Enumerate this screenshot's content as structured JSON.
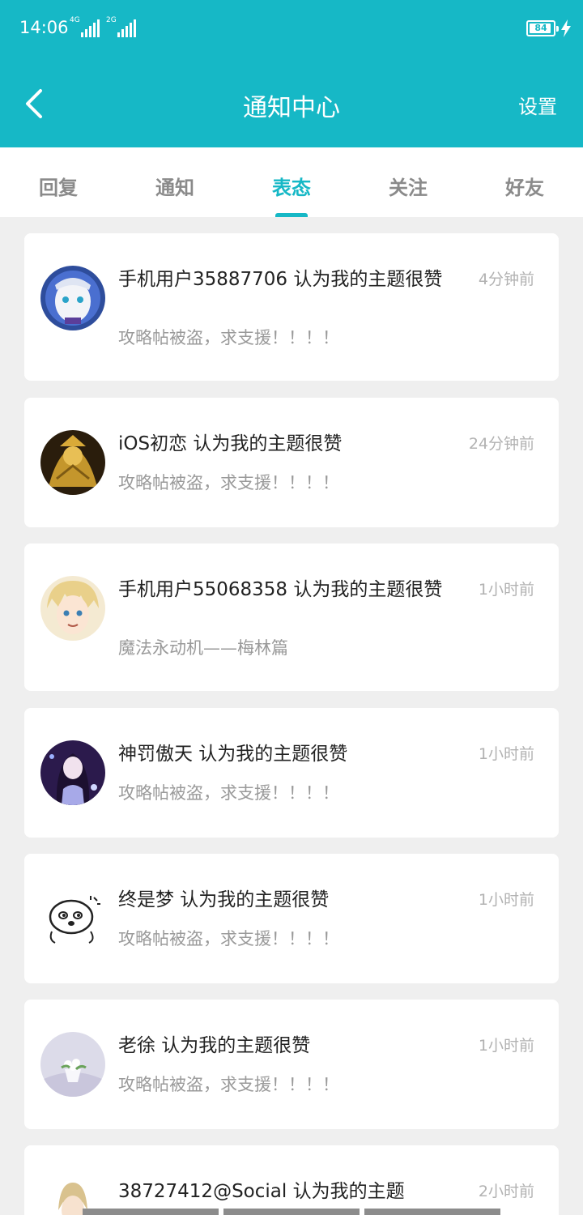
{
  "status_bar": {
    "time": "14:06",
    "network1": "4G",
    "network2": "2G",
    "battery": "84"
  },
  "header": {
    "title": "通知中心",
    "settings_label": "设置",
    "back_icon": "chevron-left-icon"
  },
  "tabs": [
    {
      "label": "回复",
      "active": false
    },
    {
      "label": "通知",
      "active": false
    },
    {
      "label": "表态",
      "active": true
    },
    {
      "label": "关注",
      "active": false
    },
    {
      "label": "好友",
      "active": false
    }
  ],
  "colors": {
    "accent": "#16b8c6",
    "background": "#efefef",
    "title_text": "#222222",
    "secondary_text": "#9a9a9a"
  },
  "notifications": [
    {
      "title": "手机用户35887706 认为我的主题很赞",
      "subtitle": "攻略帖被盗，求支援！！！！",
      "time": "4分钟前"
    },
    {
      "title": "iOS初恋 认为我的主题很赞",
      "subtitle": "攻略帖被盗，求支援！！！！",
      "time": "24分钟前"
    },
    {
      "title": "手机用户55068358 认为我的主题很赞",
      "subtitle": "魔法永动机——梅林篇",
      "time": "1小时前"
    },
    {
      "title": "神罚傲天 认为我的主题很赞",
      "subtitle": "攻略帖被盗，求支援！！！！",
      "time": "1小时前"
    },
    {
      "title": "终是梦 认为我的主题很赞",
      "subtitle": "攻略帖被盗，求支援！！！！",
      "time": "1小时前"
    },
    {
      "title": "老徐 认为我的主题很赞",
      "subtitle": "攻略帖被盗，求支援！！！！",
      "time": "1小时前"
    },
    {
      "title": "38727412@Social 认为我的主题",
      "subtitle": "",
      "time": "2小时前"
    }
  ]
}
